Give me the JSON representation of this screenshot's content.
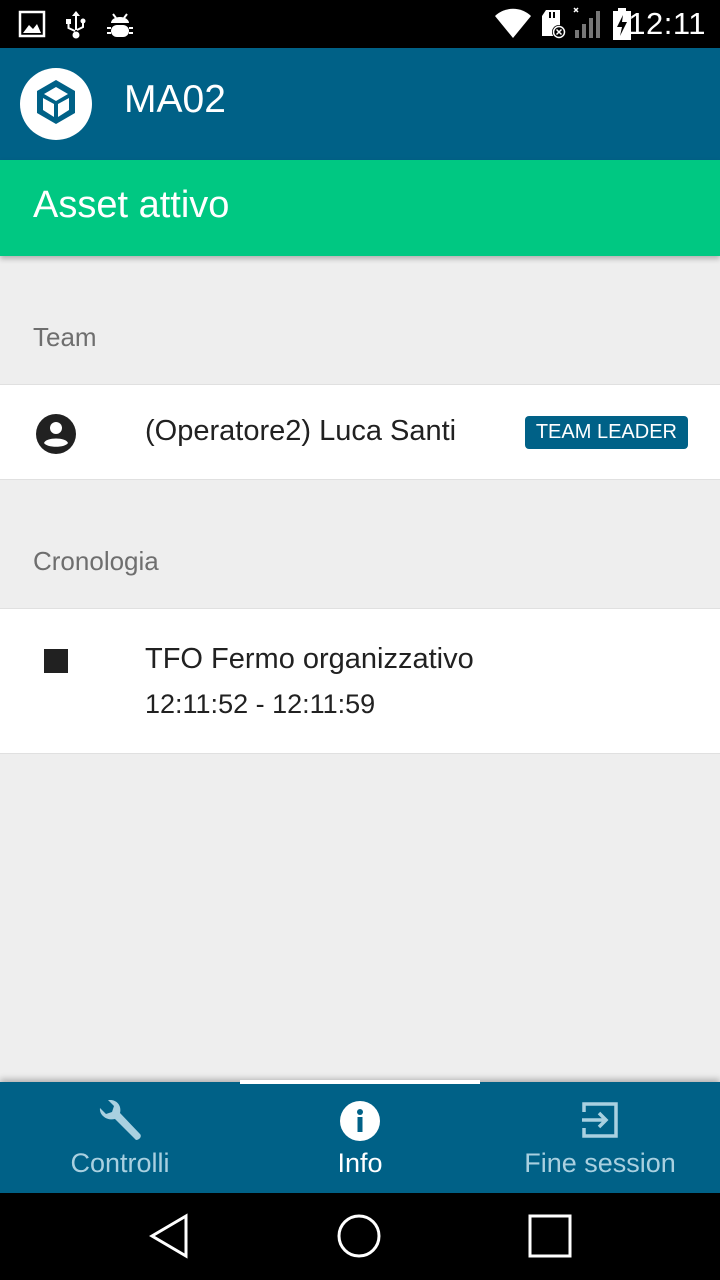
{
  "status_bar": {
    "time": "12:11",
    "left_icons": [
      "image-icon",
      "usb-icon",
      "android-debug-icon"
    ],
    "right_icons": [
      "wifi-icon",
      "sd-card-error-icon",
      "signal-icon",
      "battery-charging-icon"
    ]
  },
  "app_bar": {
    "title": "MA02",
    "logo_icon": "cube-icon"
  },
  "status_banner": {
    "text": "Asset attivo",
    "color": "#00c882"
  },
  "team_section": {
    "header": "Team",
    "members": [
      {
        "name": "(Operatore2) Luca Santi",
        "badge": "TEAM LEADER",
        "icon": "account-circle-icon"
      }
    ]
  },
  "history_section": {
    "header": "Cronologia",
    "events": [
      {
        "title": "TFO Fermo organizzativo",
        "time_range": "12:11:52 - 12:11:59",
        "icon": "stop-icon"
      }
    ]
  },
  "bottom_nav": {
    "items": [
      {
        "label": "Controlli",
        "icon": "wrench-icon",
        "active": false
      },
      {
        "label": "Info",
        "icon": "info-icon",
        "active": true
      },
      {
        "label": "Fine session",
        "icon": "exit-icon",
        "active": false
      }
    ]
  },
  "colors": {
    "primary": "#006187",
    "accent_green": "#00c882",
    "inactive_nav": "#a9d0e0"
  }
}
